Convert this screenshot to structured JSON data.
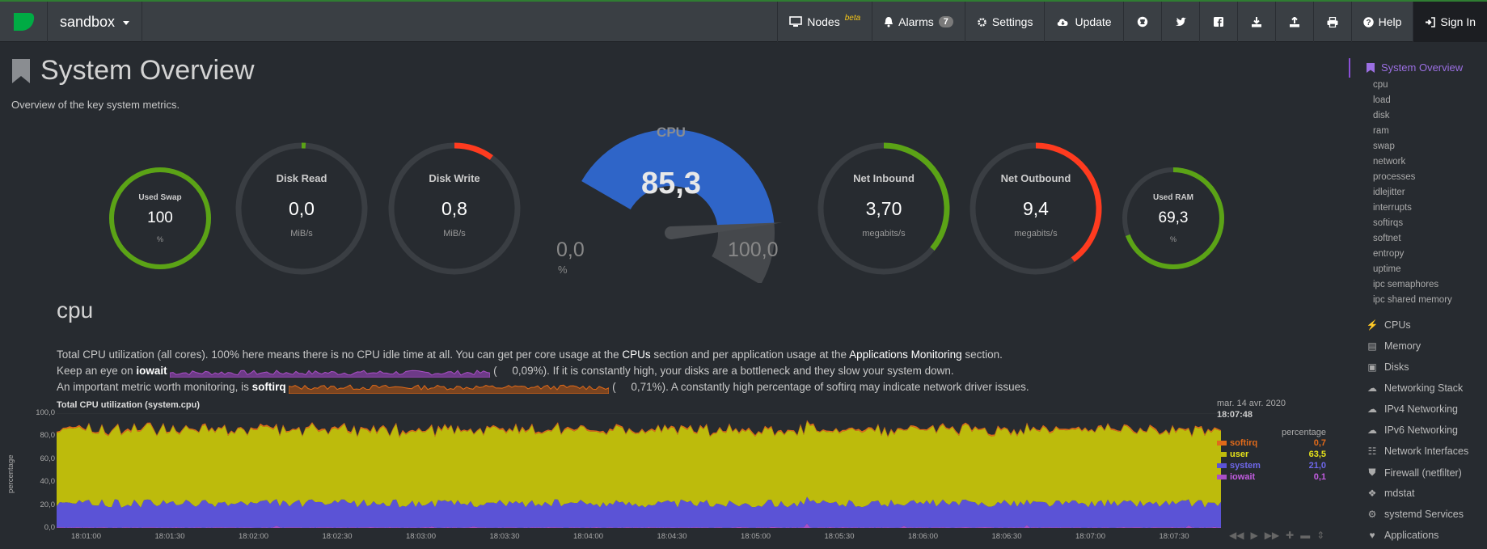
{
  "topbar": {
    "brand": "sandbox",
    "nav": [
      {
        "id": "nodes",
        "label": "Nodes",
        "sup": "beta",
        "icon": "monitor-icon"
      },
      {
        "id": "alarms",
        "label": "Alarms",
        "badge": "7",
        "icon": "bell-icon"
      },
      {
        "id": "settings",
        "label": "Settings",
        "icon": "gear-icon"
      },
      {
        "id": "update",
        "label": "Update",
        "icon": "cloud-download-icon"
      }
    ],
    "help": "Help",
    "signin": "Sign In"
  },
  "page": {
    "title": "System Overview",
    "subtitle": "Overview of the key system metrics."
  },
  "gauges": {
    "swap": {
      "label": "Used Swap",
      "value": "100",
      "unit": "%",
      "fraction": 1.0,
      "color": "#5ba316"
    },
    "disk_read": {
      "label": "Disk Read",
      "value": "0,0",
      "unit": "MiB/s",
      "fraction": 0.01,
      "color": "#5ba316"
    },
    "disk_write": {
      "label": "Disk Write",
      "value": "0,8",
      "unit": "MiB/s",
      "fraction": 0.1,
      "color": "#ff3b1f"
    },
    "cpu": {
      "label": "CPU",
      "value": "85,3",
      "min": "0,0",
      "max": "100,0",
      "unit": "%",
      "fraction": 0.853,
      "color": "#2f65c8"
    },
    "net_in": {
      "label": "Net Inbound",
      "value": "3,70",
      "unit": "megabits/s",
      "fraction": 0.36,
      "color": "#5ba316"
    },
    "net_out": {
      "label": "Net Outbound",
      "value": "9,4",
      "unit": "megabits/s",
      "fraction": 0.4,
      "color": "#ff3b1f"
    },
    "ram": {
      "label": "Used RAM",
      "value": "69,3",
      "unit": "%",
      "fraction": 0.693,
      "color": "#5ba316"
    }
  },
  "cpu_section": {
    "heading": "cpu",
    "line1_a": "Total CPU utilization (all cores). 100% here means there is no CPU idle time at all. You can get per core usage at the ",
    "line1_link1": "CPUs",
    "line1_b": " section and per application usage at the ",
    "line1_link2": "Applications Monitoring",
    "line1_c": " section.",
    "line2_a": "Keep an eye on ",
    "line2_b": "iowait",
    "line2_open": "(",
    "line2_c": "0,09%). If it is constantly high, your disks are a bottleneck and they slow your system down.",
    "line3_a": "An important metric worth monitoring, is ",
    "line3_b": "softirq",
    "line3_open": "(",
    "line3_c": "0,71%). A constantly high percentage of softirq may indicate network driver issues."
  },
  "chart_data": {
    "type": "area",
    "title": "Total CPU utilization (system.cpu)",
    "ylabel": "percentage",
    "ylim": [
      0,
      100
    ],
    "yticks": [
      "0,0",
      "20,0",
      "40,0",
      "60,0",
      "80,0",
      "100,0"
    ],
    "xticks": [
      "18:01:00",
      "18:01:30",
      "18:02:00",
      "18:02:30",
      "18:03:00",
      "18:03:30",
      "18:04:00",
      "18:04:30",
      "18:05:00",
      "18:05:30",
      "18:06:00",
      "18:06:30",
      "18:07:00",
      "18:07:30"
    ],
    "stacked": true,
    "series": [
      {
        "name": "iowait",
        "color": "#a94fc6",
        "value": "0,1",
        "level": 0.1
      },
      {
        "name": "system",
        "color": "#5b53d6",
        "value": "21,0",
        "level": 21.0
      },
      {
        "name": "user",
        "color": "#bdbb0c",
        "value": "63,5",
        "level": 63.5
      },
      {
        "name": "softirq",
        "color": "#e06a1a",
        "value": "0,7",
        "level": 0.7
      }
    ],
    "legend": {
      "date": "mar. 14 avr. 2020",
      "time": "18:07:48",
      "units": "percentage"
    }
  },
  "sidebar": {
    "active": "System Overview",
    "sub": [
      "cpu",
      "load",
      "disk",
      "ram",
      "swap",
      "network",
      "processes",
      "idlejitter",
      "interrupts",
      "softirqs",
      "softnet",
      "entropy",
      "uptime",
      "ipc semaphores",
      "ipc shared memory"
    ],
    "items": [
      {
        "label": "CPUs",
        "icon": "bolt-icon"
      },
      {
        "label": "Memory",
        "icon": "memory-icon"
      },
      {
        "label": "Disks",
        "icon": "disk-icon"
      },
      {
        "label": "Networking Stack",
        "icon": "cloud-icon"
      },
      {
        "label": "IPv4 Networking",
        "icon": "cloud-icon"
      },
      {
        "label": "IPv6 Networking",
        "icon": "cloud-icon"
      },
      {
        "label": "Network Interfaces",
        "icon": "sitemap-icon"
      },
      {
        "label": "Firewall (netfilter)",
        "icon": "shield-icon"
      },
      {
        "label": "mdstat",
        "icon": "puzzle-icon"
      },
      {
        "label": "systemd Services",
        "icon": "gears-icon"
      },
      {
        "label": "Applications",
        "icon": "heartbeat-icon"
      }
    ]
  }
}
